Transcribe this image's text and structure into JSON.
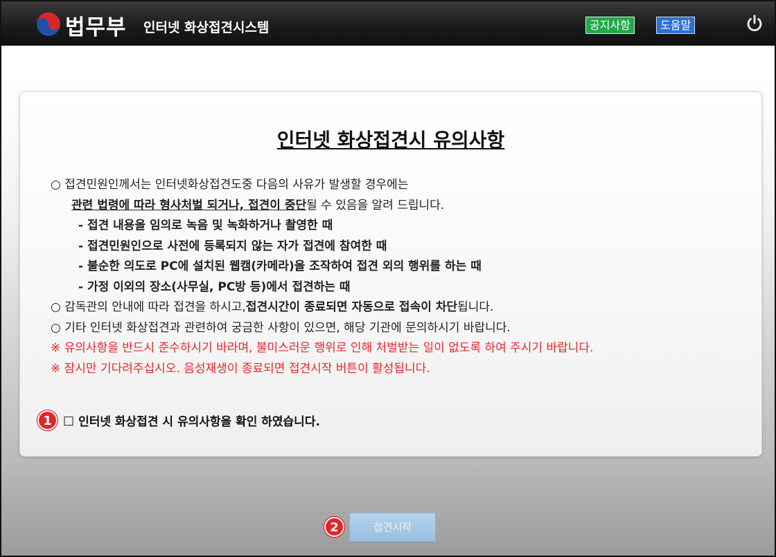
{
  "header": {
    "brand": "법무부",
    "subtitle": "인터넷 화상접견시스템",
    "notice_button": "공지사항",
    "help_button": "도움말",
    "power_icon": "power-icon",
    "logo_icon": "taegeuk-logo"
  },
  "notice": {
    "title": "인터넷 화상접견시 유의사항",
    "p1_line1": "○ 접견민원인께서는 인터넷화상접견도중 다음의 사유가 발생할 경우에는",
    "p1_line2_bold": "관련 법령에 따라 형사처벌 되거나, 접견이 중단",
    "p1_line2_rest": "될 수 있음을 알려 드립니다.",
    "items": [
      "- 접견 내용을 임의로 녹음 및 녹화하거나 촬영한 때",
      "- 접견민원인으로 사전에 등록되지 않는 자가 접견에 참여한 때",
      "- 불순한 의도로 PC에 설치된 웹캠(카메라)을 조작하여 접견 외의 행위를 하는 때",
      "- 가정 이외의 장소(사무실, PC방 등)에서 접견하는 때"
    ],
    "p2_start": "○ 감독관의 안내에 따라 접견을 하시고,",
    "p2_bold": "접견시간이 종료되면 자동으로 접속이 차단",
    "p2_end": "됩니다.",
    "p3": "○ 기타 인터넷 화상접견과 관련하여 궁금한 사항이 있으면, 해당 기관에 문의하시기 바랍니다.",
    "warn1": "※ 유의사항을 반드시 준수하시기 바라며, 불미스러운 행위로 인해 처벌받는 일이 없도록 하여 주시기 바랍니다.",
    "warn2": "※ 잠시만 기다려주십시오.  음성재생이 종료되면 접견시작 버튼이 활성됩니다."
  },
  "confirm": {
    "badge": "1",
    "checkbox": "□",
    "label": "인터넷 화상접견 시 유의사항을 확인 하였습니다."
  },
  "start": {
    "badge": "2",
    "label": "접견시작",
    "enabled": false
  },
  "colors": {
    "warning_red": "#e8262b",
    "notice_green": "#22a94a",
    "help_blue": "#2f6fd1",
    "start_disabled": "#a8c9e6"
  }
}
